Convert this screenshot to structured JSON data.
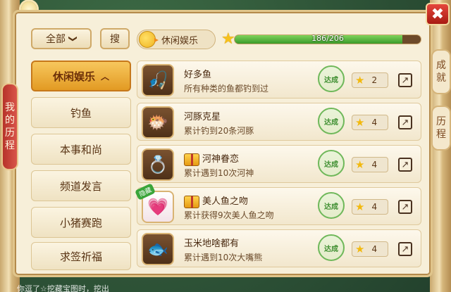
{
  "filters": {
    "all_label": "全部",
    "all_caret": "❯",
    "search_label": "搜"
  },
  "category_chip": {
    "label": "休闲娱乐"
  },
  "progress": {
    "text": "186/206",
    "current": 186,
    "total": 206
  },
  "side_tabs": {
    "left": [
      "我",
      "的",
      "历",
      "程"
    ],
    "right_top": [
      "成",
      "就"
    ],
    "right_bottom": [
      "历",
      "程"
    ]
  },
  "close_label": "✖",
  "menu": {
    "items": [
      {
        "label": "休闲娱乐",
        "active": true,
        "caret": "︿"
      },
      {
        "label": "钓鱼"
      },
      {
        "label": "本事和尚"
      },
      {
        "label": "频道发言"
      },
      {
        "label": "小猪赛跑"
      },
      {
        "label": "求签祈福"
      }
    ]
  },
  "achievements": [
    {
      "name": "好多鱼",
      "desc": "所有种类的鱼都钓到过",
      "seal": "达成",
      "reward": "2",
      "icon": "fishing-rod-icon",
      "glyph": "🎣"
    },
    {
      "name": "河豚克星",
      "desc": "累计钓到20条河豚",
      "seal": "达成",
      "reward": "4",
      "icon": "pufferfish-icon",
      "glyph": "🐡"
    },
    {
      "name": "河神眷恋",
      "desc": "累计遇到10次河神",
      "seal": "达成",
      "reward": "4",
      "icon": "jade-bracelet-icon",
      "glyph": "💍",
      "gift": true
    },
    {
      "name": "美人鱼之吻",
      "desc": "累计获得9次美人鱼之吻",
      "seal": "达成",
      "reward": "4",
      "icon": "pink-heart-icon",
      "glyph": "💗",
      "gift": true,
      "tag": "隐藏"
    },
    {
      "name": "玉米地啥都有",
      "desc": "累计遇到10次大嘴熊",
      "seal": "达成",
      "reward": "4",
      "icon": "golden-fish-icon",
      "glyph": "🐟"
    }
  ],
  "ticker": "你逗了☆挖藏宝图时，挖出"
}
